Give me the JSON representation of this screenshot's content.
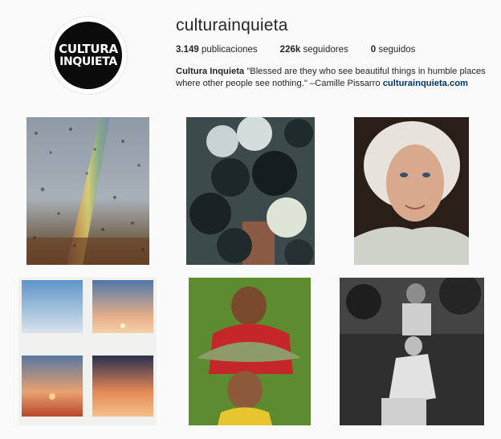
{
  "profile": {
    "avatar_line1": "CULTURA",
    "avatar_line2": "INQUIETA",
    "username": "culturainquieta",
    "stats": {
      "posts_count": "3.149",
      "posts_label": "publicaciones",
      "followers_count": "226k",
      "followers_label": "seguidores",
      "following_count": "0",
      "following_label": "seguidos"
    },
    "bio": {
      "name": "Cultura Inquieta",
      "text": " \"Blessed are they who see beautiful things in humble places where other people see nothing.\" –Camille Pissarro ",
      "link": "culturainquieta.com"
    }
  },
  "colors": {
    "link": "#003569",
    "background": "#fafafa"
  },
  "posts": [
    {
      "subject": "rainbow-rain-window-photo"
    },
    {
      "subject": "umbrellas-from-above-photo"
    },
    {
      "subject": "old-woman-portrait-photo"
    },
    {
      "subject": "four-sky-polaroids-photo"
    },
    {
      "subject": "children-leaf-umbrella-photo"
    },
    {
      "subject": "couple-on-swing-bw-photo"
    }
  ]
}
